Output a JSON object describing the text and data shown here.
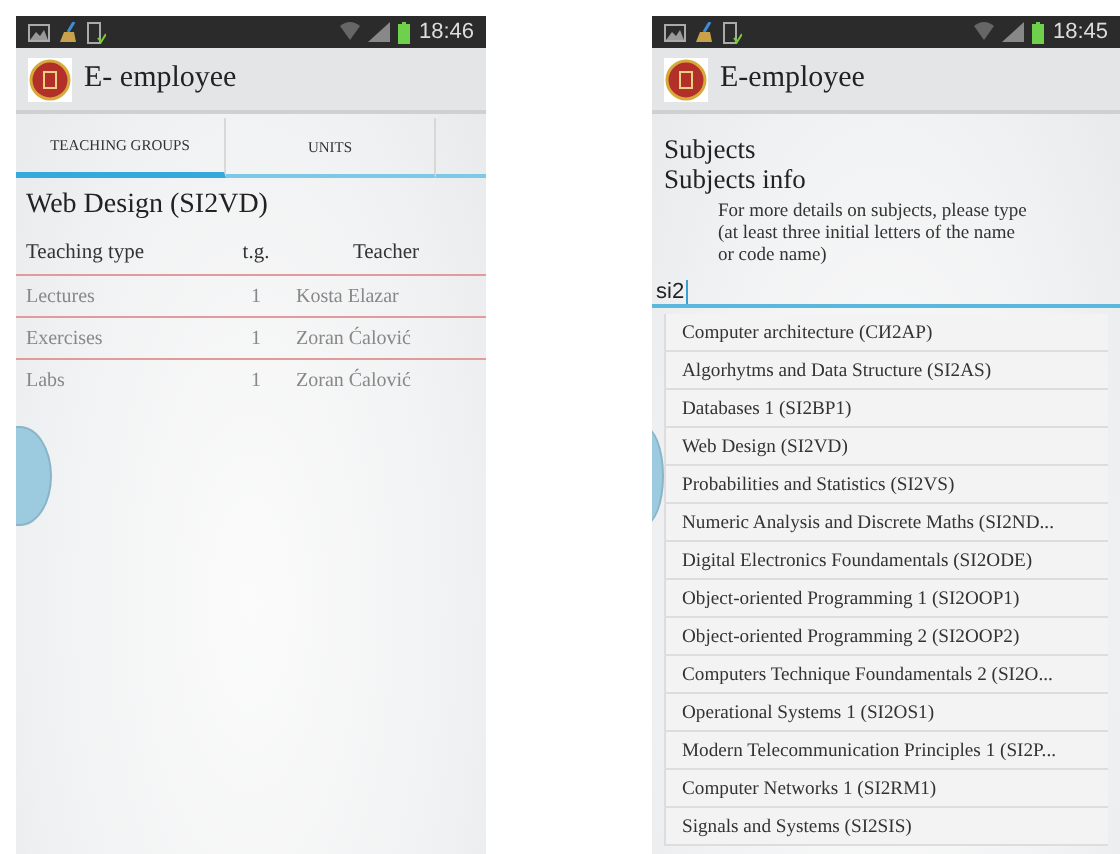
{
  "teaching_screen": {
    "status_bar": {
      "time": "18:46"
    },
    "app_bar": {
      "title": "E- employee"
    },
    "tabs": [
      {
        "label": "TEACHING GROUPS",
        "selected": true
      },
      {
        "label": "UNITS",
        "selected": false
      }
    ],
    "group_title": "Web Design (SI2VD)",
    "columns": [
      "Teaching type",
      "t.g.",
      "Teacher"
    ],
    "rows": [
      [
        "Lectures",
        "1",
        "Kosta Elazar"
      ],
      [
        "Exercises",
        "1",
        "Zoran Ćalović"
      ],
      [
        "Labs",
        "1",
        "Zoran Ćalović"
      ]
    ]
  },
  "subjects_screen": {
    "status_bar": {
      "time": "18:45"
    },
    "app_bar": {
      "title": "E-employee"
    },
    "heading": "Subjects",
    "subheading": "Subjects info",
    "hint": "For more details on subjects, please type (at least three initial letters of the name or code name)",
    "search": {
      "value": "si2"
    },
    "suggestions": [
      "Computer architecture (СИ2АР)",
      "Algorhytms and Data Structure (SI2AS)",
      "Databases 1 (SI2BP1)",
      "Web Design (SI2VD)",
      "Probabilities and Statistics (SI2VS)",
      "Numeric Analysis and Discrete Maths (SI2ND...",
      "Digital Electronics Foundamentals (SI2ODE)",
      "Object-oriented Programming 1 (SI2OOP1)",
      "Object-oriented Programming 2 (SI2OOP2)",
      "Computers Technique Foundamentals 2 (SI2O...",
      "Operational Systems 1 (SI2OS1)",
      "Modern Telecommunication Principles 1 (SI2P...",
      "Computer Networks 1 (SI2RM1)",
      "Signals and Systems (SI2SIS)"
    ]
  }
}
